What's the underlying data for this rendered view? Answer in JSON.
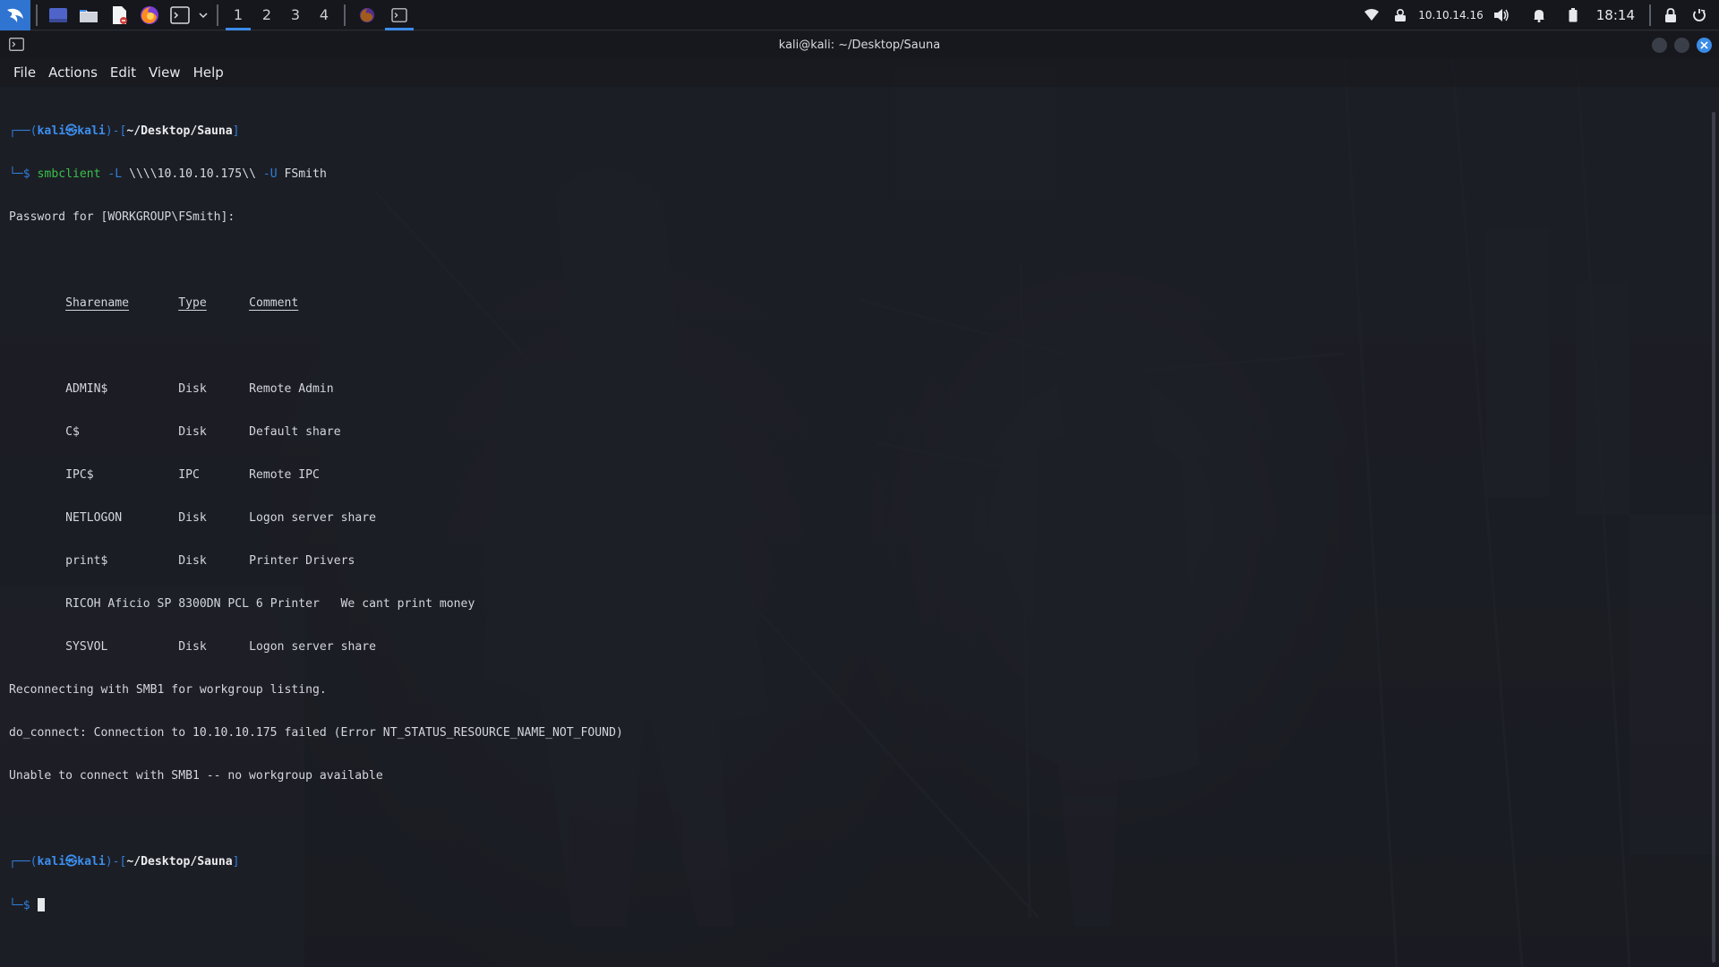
{
  "panel": {
    "workspaces": [
      "1",
      "2",
      "3",
      "4"
    ],
    "active_workspace": "1",
    "ip_address": "10.10.14.16",
    "clock": "18:14"
  },
  "window": {
    "title": "kali@kali: ~/Desktop/Sauna",
    "menu": [
      "File",
      "Actions",
      "Edit",
      "View",
      "Help"
    ]
  },
  "terminal": {
    "prompt1": {
      "user": "kali",
      "at": "㉿",
      "host": "kali",
      "path": "~/Desktop/Sauna",
      "command": "smbclient",
      "arg1": "-L",
      "arg2": "\\\\\\\\10.10.10.175\\\\",
      "arg3": "-U",
      "arg4": "FSmith"
    },
    "password_line": "Password for [WORKGROUP\\FSmith]:",
    "share_headers": [
      "Sharename",
      "Type",
      "Comment"
    ],
    "shares": [
      {
        "name": "ADMIN$",
        "type": "Disk",
        "comment": "Remote Admin"
      },
      {
        "name": "C$",
        "type": "Disk",
        "comment": "Default share"
      },
      {
        "name": "IPC$",
        "type": "IPC",
        "comment": "Remote IPC"
      },
      {
        "name": "NETLOGON",
        "type": "Disk",
        "comment": "Logon server share"
      },
      {
        "name": "print$",
        "type": "Disk",
        "comment": "Printer Drivers"
      },
      {
        "name": "RICOH Aficio SP 8300DN PCL 6",
        "type": "Printer",
        "comment": "We cant print money"
      },
      {
        "name": "SYSVOL",
        "type": "Disk",
        "comment": "Logon server share"
      }
    ],
    "output_lines": [
      "Reconnecting with SMB1 for workgroup listing.",
      "do_connect: Connection to 10.10.10.175 failed (Error NT_STATUS_RESOURCE_NAME_NOT_FOUND)",
      "Unable to connect with SMB1 -- no workgroup available"
    ],
    "prompt2": {
      "user": "kali",
      "at": "㉿",
      "host": "kali",
      "path": "~/Desktop/Sauna"
    }
  },
  "colors": {
    "accent": "#3b8ce8",
    "command_green": "#3ac04a",
    "prompt_blue": "#3b8ff0"
  },
  "icons": [
    "kali-menu-icon",
    "desktop-icon",
    "file-manager-icon",
    "text-editor-icon",
    "firefox-icon",
    "terminal-icon",
    "dropdown-icon",
    "wifi-icon",
    "vpn-icon",
    "volume-icon",
    "notification-icon",
    "battery-icon",
    "lock-icon",
    "power-icon"
  ]
}
